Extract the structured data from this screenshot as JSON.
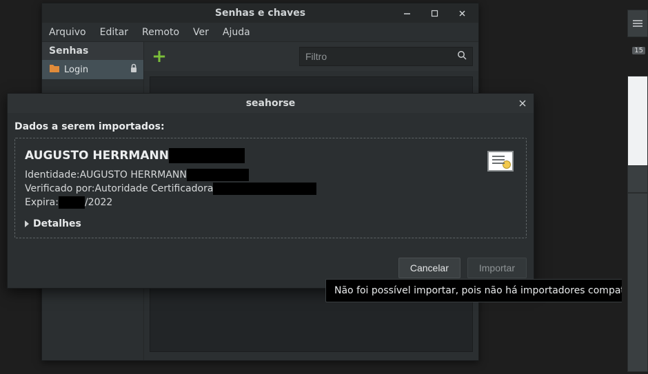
{
  "main_window": {
    "title": "Senhas e chaves",
    "menubar": {
      "arquivo": "Arquivo",
      "editar": "Editar",
      "remoto": "Remoto",
      "ver": "Ver",
      "ajuda": "Ajuda"
    },
    "sidebar": {
      "header": "Senhas",
      "login_label": "Login"
    },
    "toolbar": {
      "search_placeholder": "Filtro"
    }
  },
  "dialog": {
    "title": "seahorse",
    "heading": "Dados a serem importados:",
    "cert": {
      "name": "AUGUSTO HERRMANN",
      "identity_label": "Identidade: ",
      "identity_value": "AUGUSTO HERRMANN",
      "verified_label": "Verificado por: ",
      "verified_value": "Autoridade Certificadora",
      "expires_label": "Expira: ",
      "expires_suffix": "/2022",
      "details_label": "Detalhes"
    },
    "buttons": {
      "cancel": "Cancelar",
      "import": "Importar"
    }
  },
  "tooltip": {
    "text": "Não foi possível importar, pois não há importadores compatíveis"
  },
  "right_badge": "15"
}
